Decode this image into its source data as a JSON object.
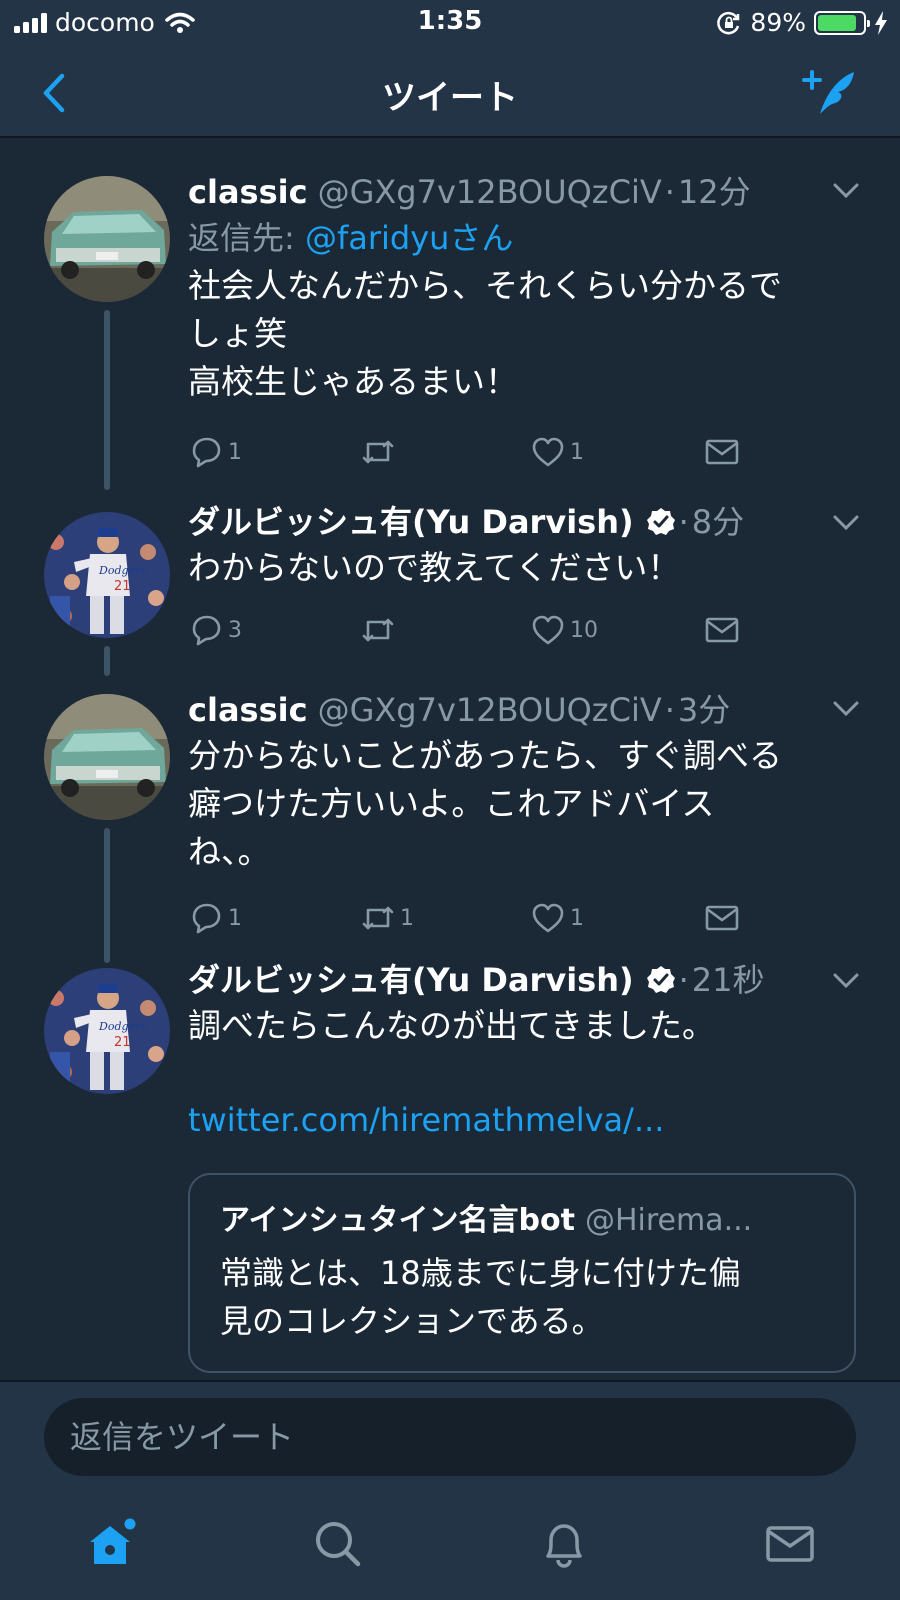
{
  "status_bar": {
    "carrier": "docomo",
    "time": "1:35",
    "battery": "89%",
    "battery_level": 0.89
  },
  "nav": {
    "title": "ツイート",
    "back_icon": "chevron-left-icon",
    "compose_icon": "compose-tweet-icon"
  },
  "tweets": [
    {
      "name": "classic",
      "handle": "@GXg7v12BOUQzCiV",
      "dot": "·",
      "time": "12分",
      "reply_to_label": "返信先: ",
      "reply_to_mention": "@faridyuさん",
      "lines": [
        "社会人なんだから、それくらい分かるで",
        "しょ笑",
        "高校生じゃあるまい！"
      ],
      "replies": "1",
      "retweets": "",
      "likes": "1"
    },
    {
      "name": "ダルビッシュ有(Yu Darvish)",
      "verified": true,
      "dot": "·",
      "time": "8分",
      "lines": [
        "わからないので教えてください！"
      ],
      "replies": "3",
      "retweets": "",
      "likes": "10"
    },
    {
      "name": "classic",
      "handle": "@GXg7v12BOUQzCiV",
      "dot": "·",
      "time": "3分",
      "lines": [
        "分からないことがあったら、すぐ調べる",
        "癖つけた方いいよ。これアドバイス",
        "ね、。"
      ],
      "replies": "1",
      "retweets": "1",
      "likes": "1"
    },
    {
      "name": "ダルビッシュ有(Yu Darvish)",
      "verified": true,
      "dot": "·",
      "time": "21秒",
      "lines": [
        "調べたらこんなのが出てきました。"
      ],
      "link": "twitter.com/hiremathmelva/...",
      "quote": {
        "name": "アインシュタイン名言bot",
        "handle": "@Hirema...",
        "lines": [
          "常識とは、18歳までに身に付けた偏",
          "見のコレクションである。"
        ]
      }
    }
  ],
  "reply_box": {
    "placeholder": "返信をツイート"
  },
  "tabs": [
    "home-icon",
    "search-icon",
    "notifications-icon",
    "messages-icon"
  ],
  "colors": {
    "background": "#1b2836",
    "bar": "#243447",
    "accent": "#1da1f2",
    "muted": "#8899a6"
  }
}
